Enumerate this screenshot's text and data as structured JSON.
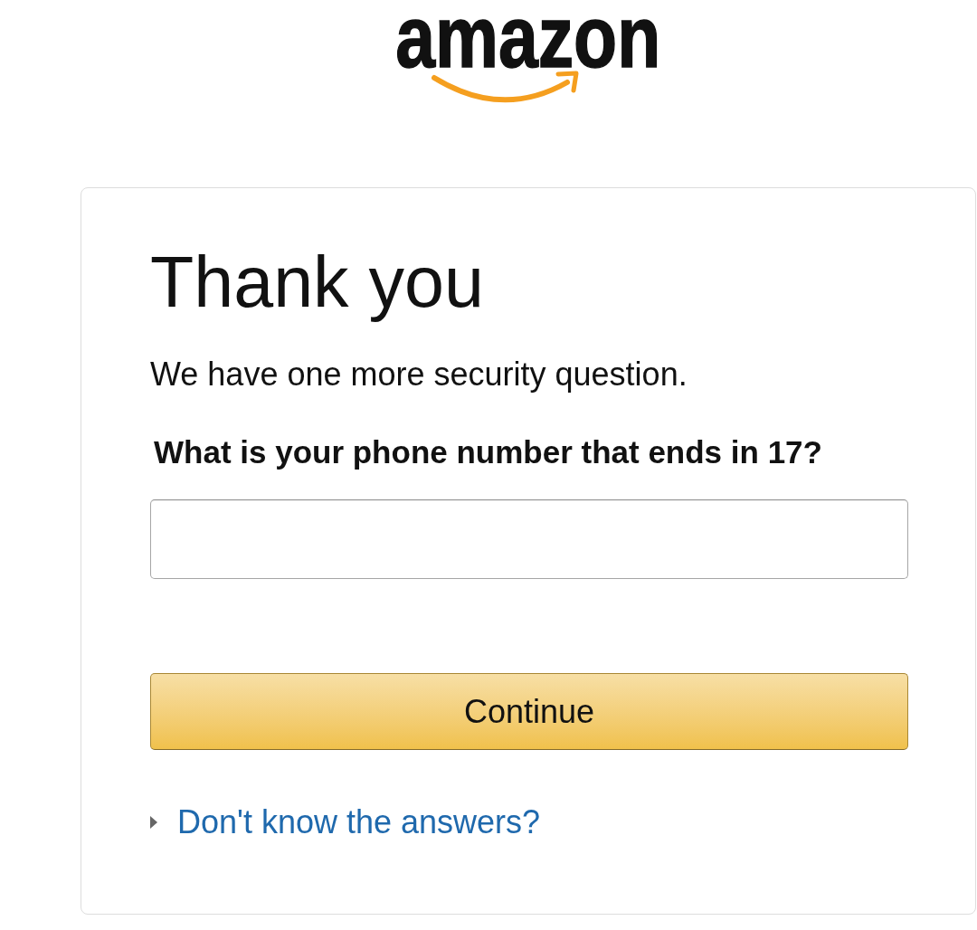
{
  "logo": {
    "text": "amazon"
  },
  "card": {
    "title": "Thank you",
    "message": "We have one more security question.",
    "question": "What is your phone number that ends in 17?",
    "continue_button": "Continue",
    "help_link": {
      "label": "Don't know the answers?",
      "expanded": false
    }
  }
}
